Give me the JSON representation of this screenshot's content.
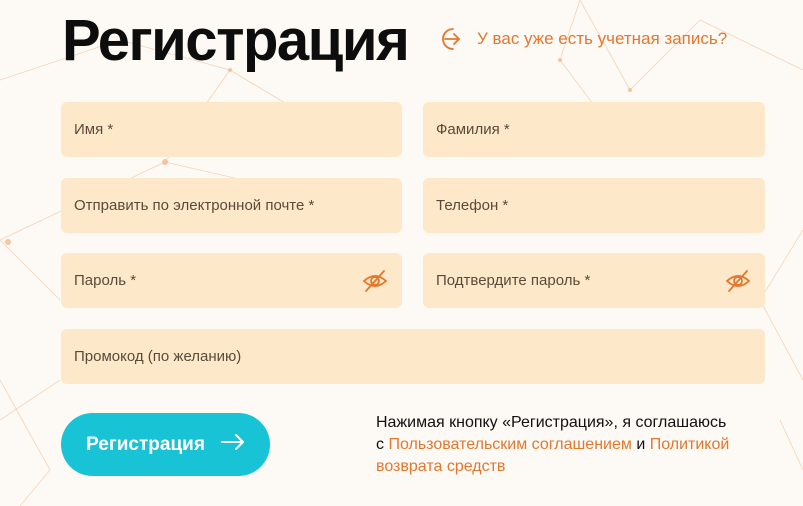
{
  "title": "Регистрация",
  "login_link": {
    "label": "У вас уже есть учетная запись?",
    "icon": "arrow-right-circle-icon"
  },
  "fields": {
    "first_name": "Имя *",
    "last_name": "Фамилия *",
    "email": "Отправить по электронной почте *",
    "phone": "Телефон *",
    "password": "Пароль *",
    "confirm_password": "Подтвердите пароль *",
    "promo": "Промокод (по желанию)"
  },
  "submit": {
    "label": "Регистрация",
    "icon": "arrow-right-icon"
  },
  "terms": {
    "line1": "Нажимая кнопку «Регистрация», я соглашаюсь",
    "prefix": "с",
    "user_agreement": "Пользовательским соглашением",
    "conjunction": "и",
    "refund_policy": "Политикой возврата средств"
  },
  "colors": {
    "accent": "#e2782e",
    "field_bg": "#fde9c9",
    "button": "#19c3d6",
    "background": "#fdf9f4"
  }
}
